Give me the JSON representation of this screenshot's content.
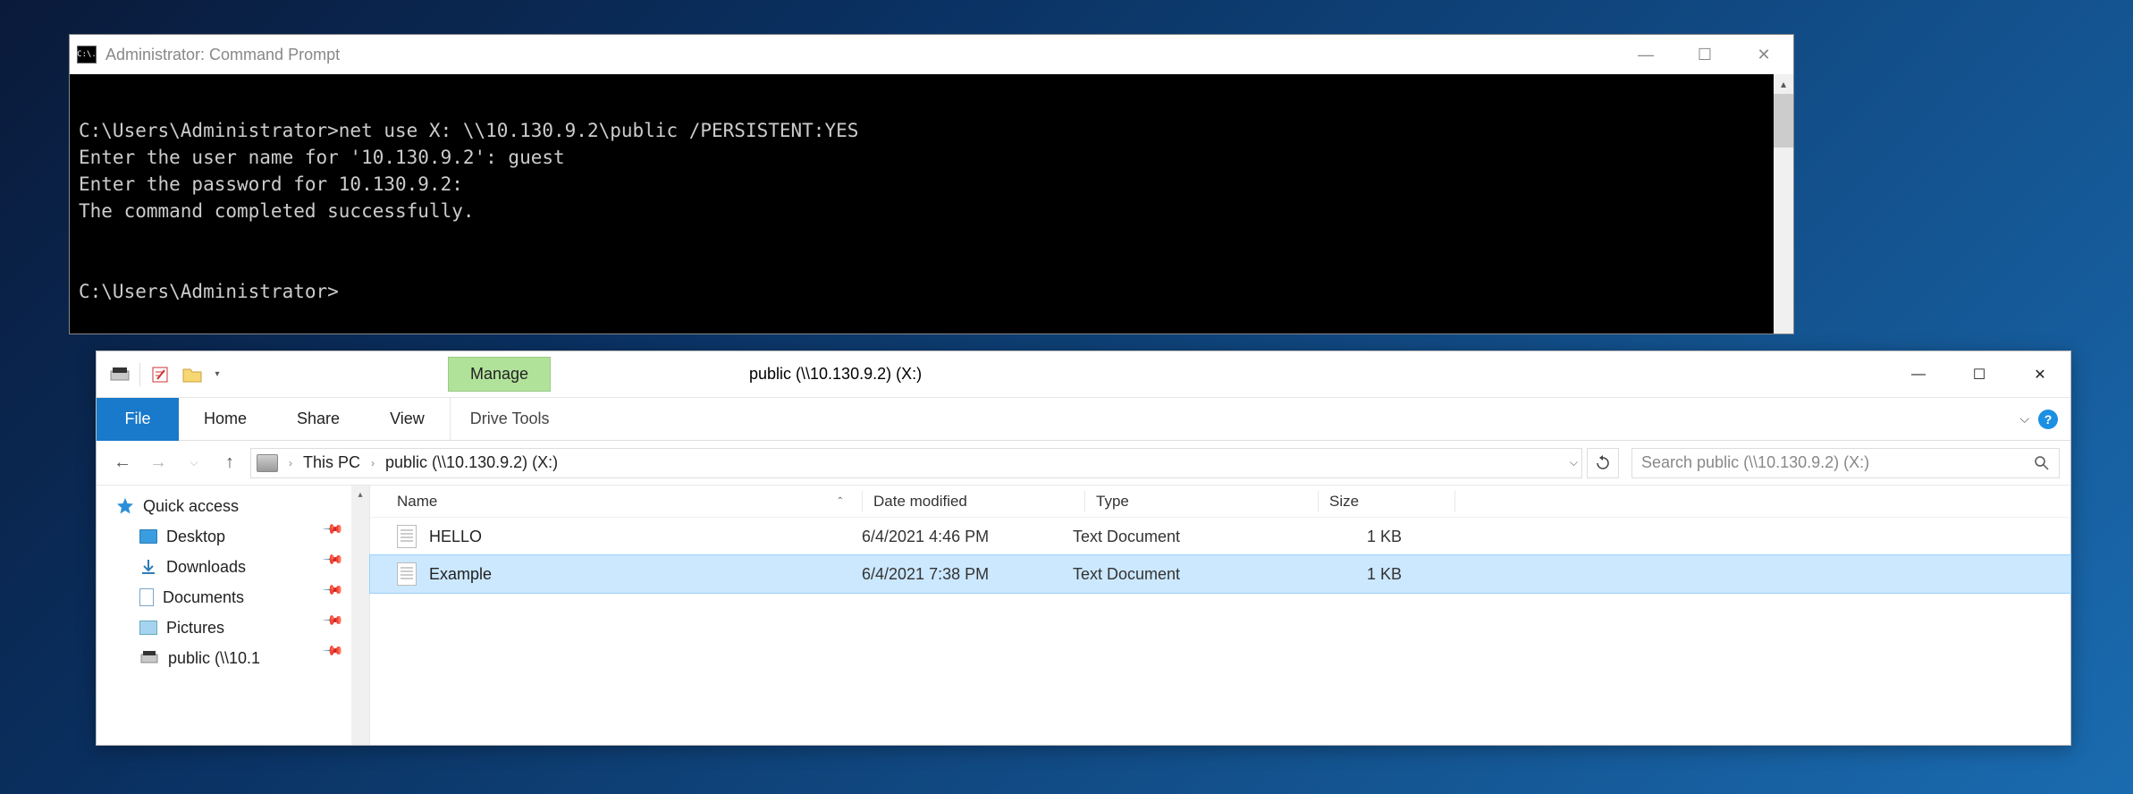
{
  "cmd": {
    "title": "Administrator: Command Prompt",
    "icon_label": "C:\\.",
    "lines": "C:\\Users\\Administrator>net use X: \\\\10.130.9.2\\public /PERSISTENT:YES\nEnter the user name for '10.130.9.2': guest\nEnter the password for 10.130.9.2:\nThe command completed successfully.\n\n\nC:\\Users\\Administrator>"
  },
  "explorer": {
    "title": "public (\\\\10.130.9.2) (X:)",
    "manage_label": "Manage",
    "drive_tools_label": "Drive Tools",
    "ribbon": {
      "file": "File",
      "home": "Home",
      "share": "Share",
      "view": "View"
    },
    "breadcrumb": {
      "root": "This PC",
      "current": "public (\\\\10.130.9.2) (X:)"
    },
    "search_placeholder": "Search public (\\\\10.130.9.2) (X:)",
    "nav": {
      "quick_access": "Quick access",
      "items": [
        {
          "label": "Desktop"
        },
        {
          "label": "Downloads"
        },
        {
          "label": "Documents"
        },
        {
          "label": "Pictures"
        },
        {
          "label": "public (\\\\10.1"
        }
      ]
    },
    "columns": {
      "name": "Name",
      "date": "Date modified",
      "type": "Type",
      "size": "Size"
    },
    "files": [
      {
        "name": "HELLO",
        "date": "6/4/2021 4:46 PM",
        "type": "Text Document",
        "size": "1 KB"
      },
      {
        "name": "Example",
        "date": "6/4/2021 7:38 PM",
        "type": "Text Document",
        "size": "1 KB"
      }
    ]
  }
}
